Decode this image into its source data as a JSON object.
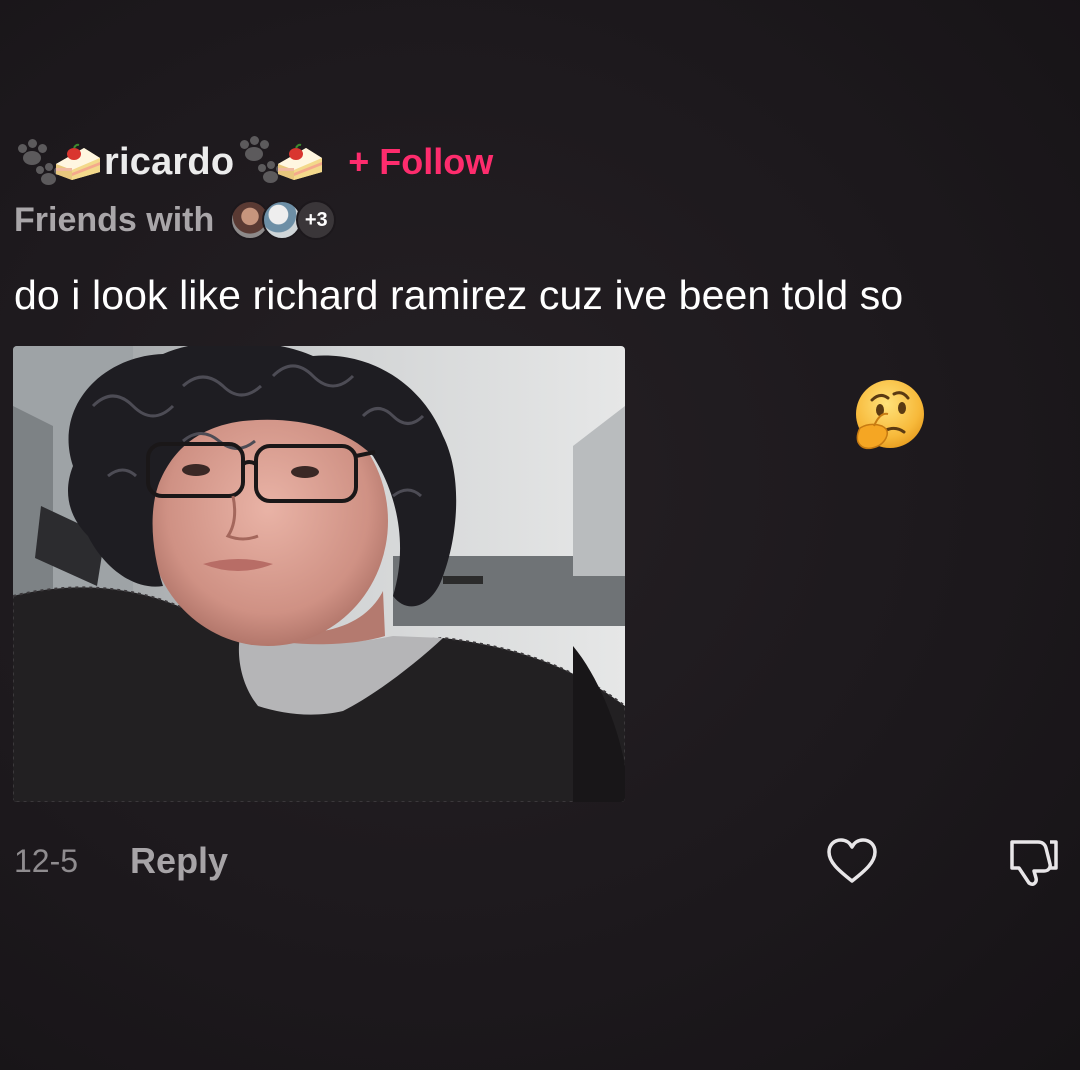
{
  "comment": {
    "username": "ricardo",
    "follow_label": "+ Follow",
    "friends_label": "Friends with",
    "friends_more": "+3",
    "text": "do i look like richard ramirez cuz ive been told so",
    "date": "12-5",
    "reply_label": "Reply"
  },
  "icons": {
    "paw": "paw-icon",
    "cake": "cake-icon",
    "thinking": "thinking-face-emoji",
    "like": "heart-outline-icon",
    "dislike": "thumbs-down-outline-icon"
  },
  "colors": {
    "background": "#1c181c",
    "follow_accent": "#fe2c6d",
    "muted_text": "#a9a6a9"
  }
}
